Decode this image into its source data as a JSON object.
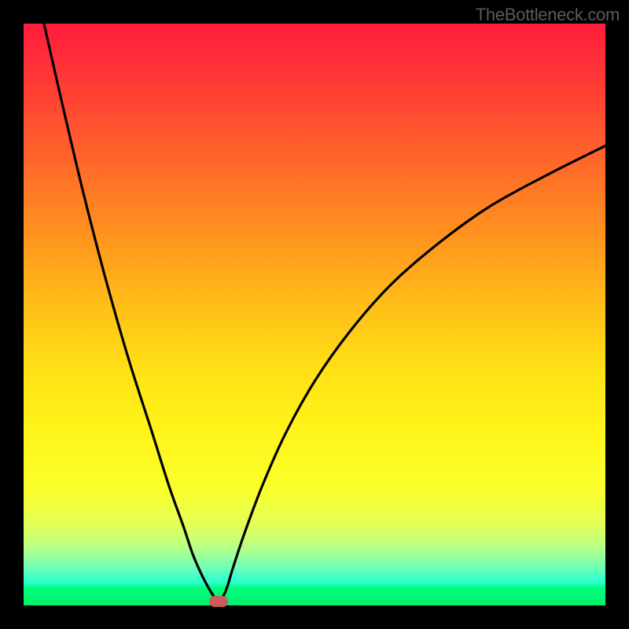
{
  "watermark": "TheBottleneck.com",
  "chart_data": {
    "type": "line",
    "title": "",
    "xlabel": "",
    "ylabel": "",
    "xlim": [
      0,
      100
    ],
    "ylim": [
      0,
      100
    ],
    "background_gradient": {
      "top": "#ff1c3c",
      "middle": "#ffe216",
      "bottom": "#00f068"
    },
    "series": [
      {
        "name": "curve",
        "color": "#000000",
        "x": [
          3.5,
          6,
          10,
          14,
          18,
          22,
          25,
          27.5,
          29,
          30.5,
          31.8,
          32.8,
          33.5,
          34.2,
          35,
          36,
          38,
          41,
          45,
          50,
          56,
          63,
          71,
          80,
          90,
          100
        ],
        "y": [
          100,
          89,
          72,
          56.5,
          42.5,
          30,
          20.5,
          13.5,
          9,
          5.5,
          3,
          1.4,
          0.6,
          1.4,
          3.2,
          6.5,
          12.5,
          20.5,
          29.5,
          38.5,
          47,
          55,
          62,
          68.5,
          74,
          79
        ]
      }
    ],
    "marker": {
      "x": 33.5,
      "y": 0.7,
      "color": "#cc5b5b"
    },
    "grid": false
  }
}
